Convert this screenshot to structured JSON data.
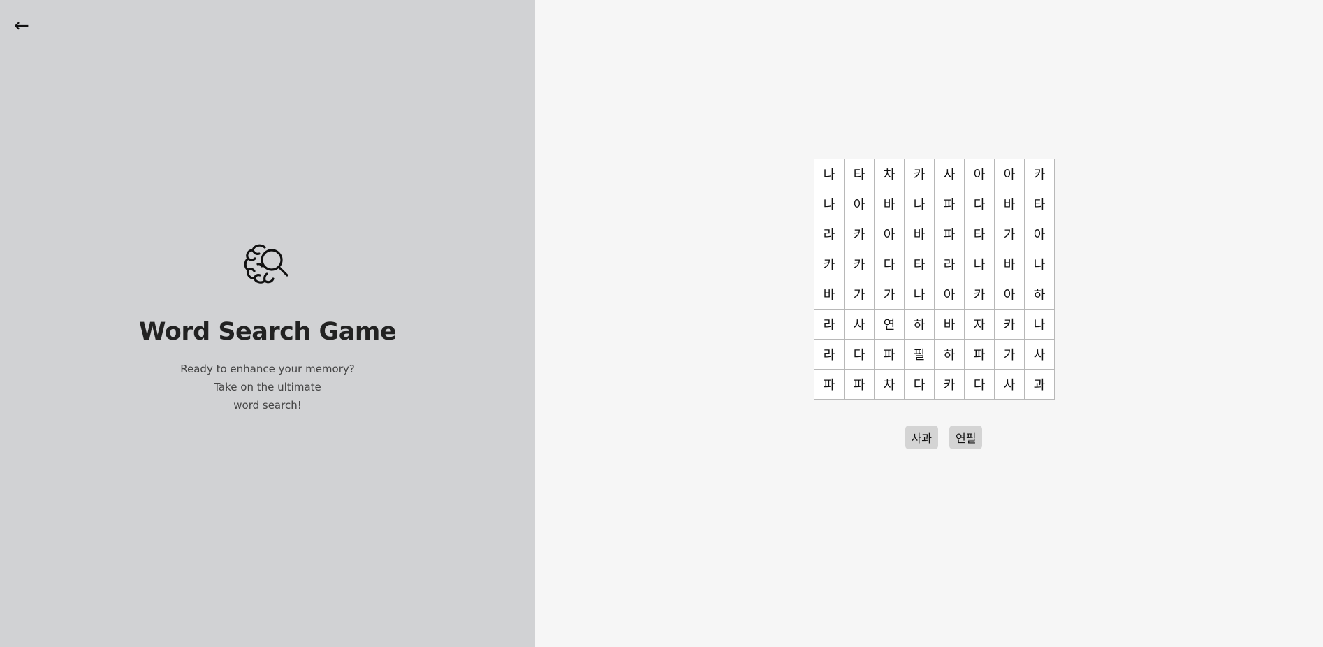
{
  "nav": {
    "back_glyph": "←"
  },
  "intro": {
    "icon": "brain-search-icon",
    "title": "Word Search Game",
    "subtitle_lines": [
      "Ready to enhance your memory?",
      "Take on the ultimate",
      "word search!"
    ]
  },
  "grid": {
    "rows": [
      [
        "나",
        "타",
        "차",
        "카",
        "사",
        "아",
        "아",
        "카"
      ],
      [
        "나",
        "아",
        "바",
        "나",
        "파",
        "다",
        "바",
        "타"
      ],
      [
        "라",
        "카",
        "아",
        "바",
        "파",
        "타",
        "가",
        "아"
      ],
      [
        "카",
        "카",
        "다",
        "타",
        "라",
        "나",
        "바",
        "나"
      ],
      [
        "바",
        "가",
        "가",
        "나",
        "아",
        "카",
        "아",
        "하"
      ],
      [
        "라",
        "사",
        "연",
        "하",
        "바",
        "자",
        "카",
        "나"
      ],
      [
        "라",
        "다",
        "파",
        "필",
        "하",
        "파",
        "가",
        "사"
      ],
      [
        "파",
        "파",
        "차",
        "다",
        "카",
        "다",
        "사",
        "과"
      ]
    ]
  },
  "words": [
    "사과",
    "연필"
  ],
  "colors": {
    "left_panel": "#d1d2d4",
    "right_panel": "#f6f6f6",
    "chip": "#d4d4d4"
  }
}
